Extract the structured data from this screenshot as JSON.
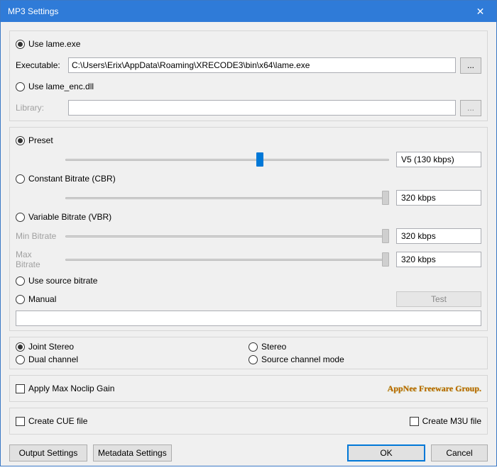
{
  "title": "MP3 Settings",
  "encoder": {
    "use_lame_exe": "Use lame.exe",
    "executable_label": "Executable:",
    "executable_path": "C:\\Users\\Erix\\AppData\\Roaming\\XRECODE3\\bin\\x64\\lame.exe",
    "browse": "...",
    "use_lame_enc_dll": "Use lame_enc.dll",
    "library_label": "Library:",
    "library_path": ""
  },
  "bitrate": {
    "preset": "Preset",
    "preset_value": "V5 (130 kbps)",
    "cbr": "Constant Bitrate (CBR)",
    "cbr_value": "320 kbps",
    "vbr": "Variable Bitrate (VBR)",
    "min_label": "Min Bitrate",
    "min_value": "320 kbps",
    "max_label": "Max Bitrate",
    "max_value": "320 kbps",
    "use_source": "Use source bitrate",
    "manual": "Manual",
    "test": "Test"
  },
  "channels": {
    "joint_stereo": "Joint Stereo",
    "stereo": "Stereo",
    "dual_channel": "Dual channel",
    "source_channel": "Source channel mode"
  },
  "noclip": {
    "label": "Apply Max Noclip Gain",
    "watermark": "AppNee Freeware Group."
  },
  "files": {
    "cue": "Create CUE file",
    "m3u": "Create M3U file"
  },
  "buttons": {
    "output": "Output Settings",
    "metadata": "Metadata Settings",
    "ok": "OK",
    "cancel": "Cancel"
  }
}
